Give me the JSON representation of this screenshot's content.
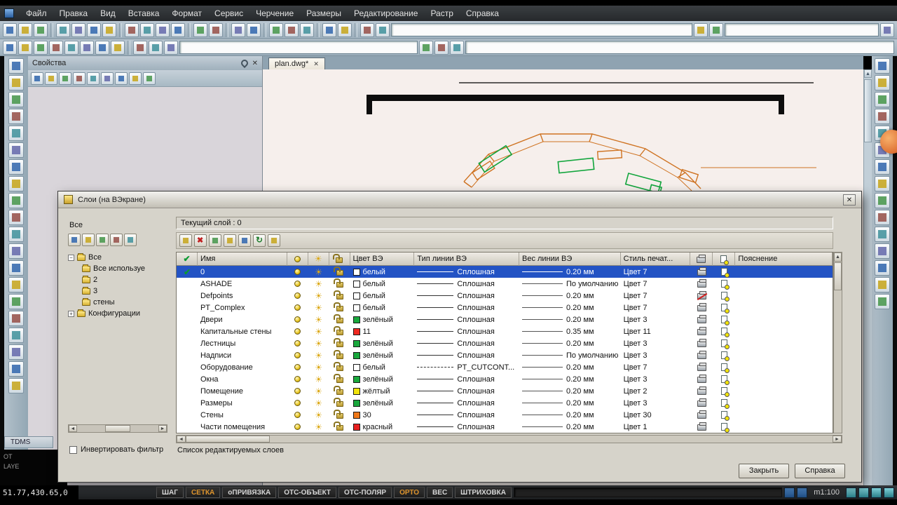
{
  "app": {
    "coords": "51.77,430.65,0",
    "scale": "m1:100"
  },
  "menu": {
    "items": [
      "Файл",
      "Правка",
      "Вид",
      "Вставка",
      "Формат",
      "Сервис",
      "Черчение",
      "Размеры",
      "Редактирование",
      "Растр",
      "Справка"
    ]
  },
  "toolbars": {
    "main_a": [
      "new-file",
      "open",
      "save",
      "|",
      "print",
      "print-preview",
      "plot",
      "batch-plot",
      "|",
      "cut",
      "copy",
      "paste",
      "format-painter",
      "|",
      "undo",
      "redo",
      "|",
      "spray",
      "zoom",
      "|",
      "zoom-window",
      "zoom-dynamic",
      "zoom-extents",
      "|",
      "measure",
      "edit-pencil",
      "|",
      "help-info",
      "notes"
    ],
    "main_b": [
      "sheet-set",
      "markup"
    ],
    "main_c": [
      "screen-capture"
    ],
    "secondary_a": [
      "select-cursor",
      "node-snap",
      "grid-snap",
      "ortho-mode",
      "osnap-settings",
      "object-track",
      "polar-track",
      "align",
      "|",
      "layer-manager",
      "layer-states",
      "layer-previous"
    ],
    "secondary_b": [
      "layers-stack",
      "layer-freeze",
      "layer-lock"
    ],
    "left": [
      "select-arrow",
      "line",
      "polyline",
      "circle",
      "arc",
      "rectangle",
      "ellipse",
      "spline",
      "point",
      "hatch",
      "gradient",
      "region",
      "table-draw",
      "text",
      "dimension",
      "leader",
      "block",
      "insert-block",
      "image-attach",
      "revision-cloud"
    ],
    "right": [
      "erase",
      "copy-object",
      "mirror",
      "offset",
      "array",
      "move",
      "rotate",
      "scale",
      "stretch",
      "trim",
      "extend",
      "break",
      "chamfer",
      "fillet",
      "explode"
    ]
  },
  "properties": {
    "title": "Свойства",
    "toolbar": [
      "select-objects",
      "quick-select",
      "copy-properties",
      "match-properties",
      "pin-panel",
      "expand-all",
      "collapse-all",
      "panel-settings",
      "panel-help"
    ]
  },
  "document": {
    "tab": "plan.dwg*"
  },
  "left_dock": {
    "tab": "TDMS",
    "console_line1": "ОТ",
    "console_line2": "LAYE"
  },
  "dialog": {
    "title": "Слои (на ВЭкране)",
    "filter_root_label": "Все",
    "current_layer_label": "Текущий слой : 0",
    "tree": {
      "root": "Все",
      "children": [
        "Все используе",
        "2",
        "3",
        "стены"
      ],
      "config_root": "Конфигурации"
    },
    "tree_toolbar": [
      "new-group-filter",
      "new-property-filter",
      "delete-filter",
      "select-filter",
      "invert-selection"
    ],
    "table_toolbar": [
      "layer-on-all",
      "delete-layer",
      "isolate-layer",
      "layers-a",
      "layers-b",
      "refresh",
      "layer-filters"
    ],
    "invert_filter_label": "Инвертировать фильтр",
    "list_hint": "Список редактируемых слоев",
    "buttons": {
      "close": "Закрыть",
      "help": "Справка"
    },
    "table": {
      "header": [
        {
          "icon": "check-icon"
        },
        {
          "label": "Имя"
        },
        {
          "icon": "lamp-icon"
        },
        {
          "icon": "sun-icon"
        },
        {
          "icon": "lock-icon"
        },
        {
          "label": "Цвет ВЭ"
        },
        {
          "label": "Тип линии ВЭ"
        },
        {
          "label": "Вес линии ВЭ"
        },
        {
          "label": "Стиль печат..."
        },
        {
          "icon": "printer-icon"
        },
        {
          "icon": "page-color-icon"
        },
        {
          "label": "Пояснение"
        }
      ],
      "rows": [
        {
          "name": "0",
          "current": true,
          "selected": true,
          "color_name": "белый",
          "color": "#ffffff",
          "linetype": "Сплошная",
          "weight": "0.20 мм",
          "print": "Цвет 7"
        },
        {
          "name": "ASHADE",
          "color_name": "белый",
          "color": "#ffffff",
          "linetype": "Сплошная",
          "weight": "По умолчанию",
          "print": "Цвет 7"
        },
        {
          "name": "Defpoints",
          "noplot": true,
          "color_name": "белый",
          "color": "#ffffff",
          "linetype": "Сплошная",
          "weight": "0.20 мм",
          "print": "Цвет 7"
        },
        {
          "name": "PT_Complex",
          "color_name": "белый",
          "color": "#ffffff",
          "linetype": "Сплошная",
          "weight": "0.20 мм",
          "print": "Цвет 7"
        },
        {
          "name": "Двери",
          "color_name": "зелёный",
          "color": "#19a83c",
          "linetype": "Сплошная",
          "weight": "0.20 мм",
          "print": "Цвет 3"
        },
        {
          "name": "Капитальные стены",
          "color_name": "11",
          "color": "#f02820",
          "linetype": "Сплошная",
          "weight": "0.35 мм",
          "print": "Цвет 11"
        },
        {
          "name": "Лестницы",
          "color_name": "зелёный",
          "color": "#19a83c",
          "linetype": "Сплошная",
          "weight": "0.20 мм",
          "print": "Цвет 3"
        },
        {
          "name": "Надписи",
          "color_name": "зелёный",
          "color": "#19a83c",
          "linetype": "Сплошная",
          "weight": "По умолчанию",
          "print": "Цвет 3"
        },
        {
          "name": "Оборудование",
          "color_name": "белый",
          "color": "#ffffff",
          "linetype": "PT_CUTCONT...",
          "dash": true,
          "weight": "0.20 мм",
          "print": "Цвет 7"
        },
        {
          "name": "Окна",
          "color_name": "зелёный",
          "color": "#19a83c",
          "linetype": "Сплошная",
          "weight": "0.20 мм",
          "print": "Цвет 3"
        },
        {
          "name": "Помещение",
          "color_name": "жёлтый",
          "color": "#f2e40a",
          "linetype": "Сплошная",
          "weight": "0.20 мм",
          "print": "Цвет 2"
        },
        {
          "name": "Размеры",
          "color_name": "зелёный",
          "color": "#19a83c",
          "linetype": "Сплошная",
          "weight": "0.20 мм",
          "print": "Цвет 3"
        },
        {
          "name": "Стены",
          "color_name": "30",
          "color": "#f07818",
          "linetype": "Сплошная",
          "weight": "0.20 мм",
          "print": "Цвет 30"
        },
        {
          "name": "Части помещения",
          "color_name": "красный",
          "color": "#e82020",
          "linetype": "Сплошная",
          "weight": "0.20 мм",
          "print": "Цвет 1"
        }
      ]
    }
  },
  "statusbar": {
    "buttons": [
      {
        "label": "ШАГ",
        "active": false
      },
      {
        "label": "СЕТКА",
        "active": true
      },
      {
        "label": "оПРИВЯЗКА",
        "active": false
      },
      {
        "label": "ОТС-ОБЪЕКТ",
        "active": false
      },
      {
        "label": "ОТС-ПОЛЯР",
        "active": false
      },
      {
        "label": "ОРТО",
        "active": true
      },
      {
        "label": "ВЕС",
        "active": false
      },
      {
        "label": "ШТРИХОВКА",
        "active": false
      }
    ],
    "left_icons": [
      "status-screen",
      "status-tablet"
    ],
    "right_icons": [
      "status-wheel",
      "status-zoom",
      "status-mag",
      "status-lock"
    ]
  }
}
